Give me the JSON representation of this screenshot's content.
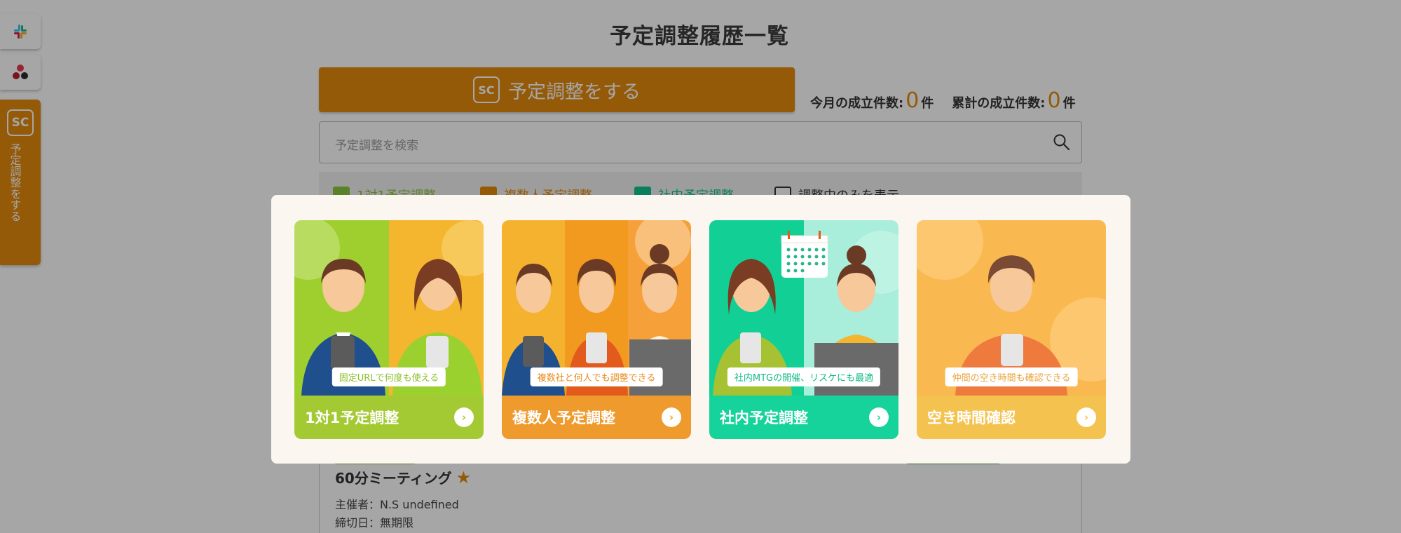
{
  "sidebar": {
    "slack_icon": "slack-icon",
    "asana_icon": "asana-icon",
    "tab_logo": "SC",
    "tab_label": "予定調整をする"
  },
  "header": {
    "title": "予定調整履歴一覧"
  },
  "toolbar": {
    "cta_logo": "SC",
    "cta_label": "予定調整をする"
  },
  "stats": {
    "monthly_label": "今月の成立件数:",
    "monthly_count": "0",
    "monthly_unit": "件",
    "total_label": "累計の成立件数:",
    "total_count": "0",
    "total_unit": "件"
  },
  "search": {
    "placeholder": "予定調整を検索"
  },
  "filters": [
    {
      "label": "1対1予定調整",
      "checked": true,
      "color": "#8cc63f"
    },
    {
      "label": "複数人予定調整",
      "checked": true,
      "color": "#e38b0d"
    },
    {
      "label": "社内予定調整",
      "checked": true,
      "color": "#10c48e"
    },
    {
      "label": "調整中のみを表示",
      "checked": false,
      "color": "#333333"
    }
  ],
  "meeting": {
    "title": "60分ミーティング",
    "star": "★",
    "owner": "主催者：N.S undefined",
    "deadline": "締切日：無期限"
  },
  "modal": {
    "options": [
      {
        "label": "1対1予定調整",
        "tag": "固定URLで何度も使える",
        "color": "#a3c933",
        "arrow": "›"
      },
      {
        "label": "複数人予定調整",
        "tag": "複数社と何人でも調整できる",
        "color": "#ee9a2c",
        "arrow": "›"
      },
      {
        "label": "社内予定調整",
        "tag": "社内MTGの開催、リスケにも最適",
        "color": "#15d39a",
        "arrow": "›"
      },
      {
        "label": "空き時間確認",
        "tag": "仲間の空き時間も確認できる",
        "color": "#f4c24e",
        "arrow": "›"
      }
    ]
  },
  "colors": {
    "brand_orange": "#e38b0d",
    "modal_bg": "#fbf7f0"
  }
}
